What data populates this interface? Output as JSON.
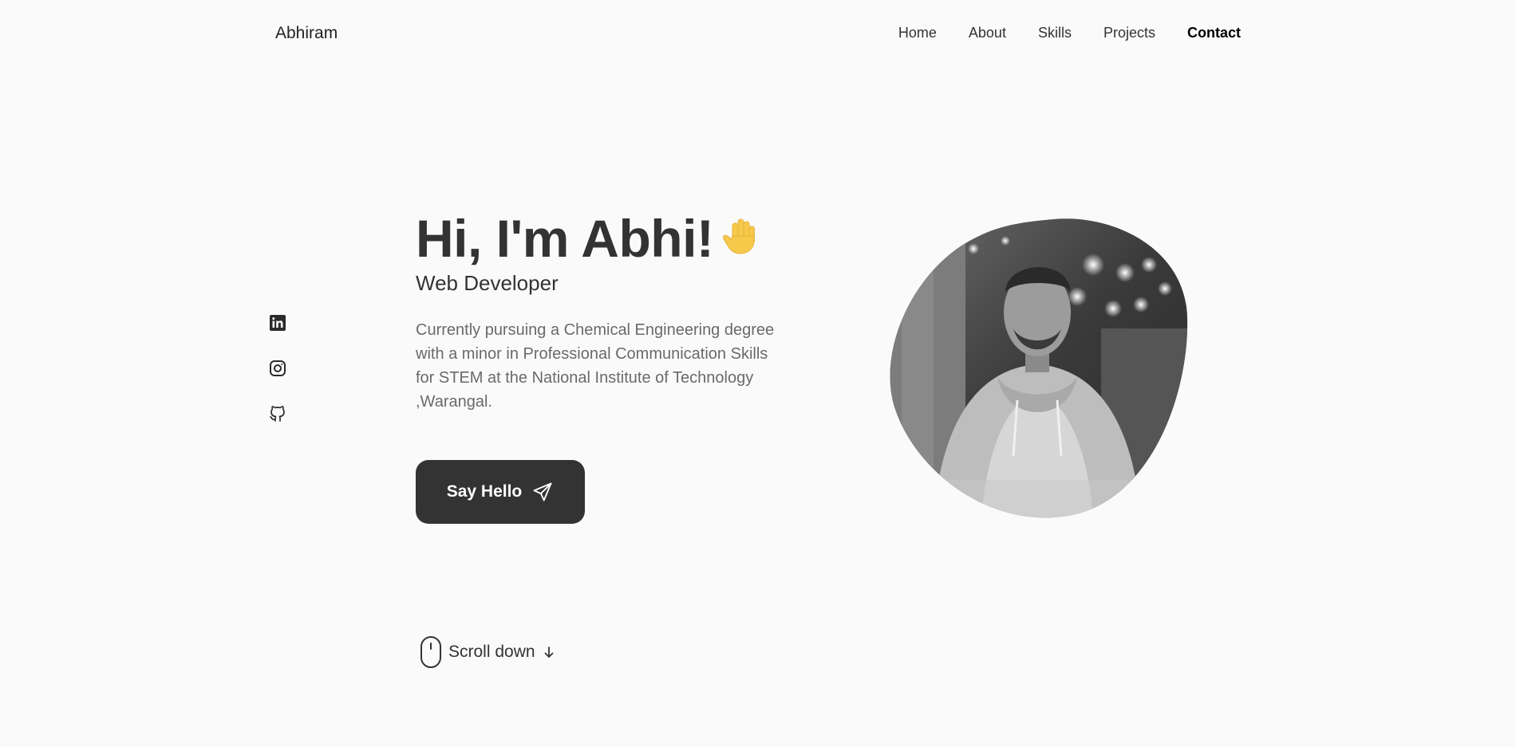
{
  "header": {
    "logo": "Abhiram",
    "nav": [
      {
        "label": "Home"
      },
      {
        "label": "About"
      },
      {
        "label": "Skills"
      },
      {
        "label": "Projects"
      },
      {
        "label": "Contact",
        "active": true
      }
    ]
  },
  "socials": [
    "linkedin-icon",
    "instagram-icon",
    "github-icon"
  ],
  "hero": {
    "title": "Hi, I'm Abhi!",
    "wave": "🖐",
    "subtitle": "Web Developer",
    "description": "Currently pursuing a Chemical Engineering degree with a minor in Professional Communication Skills for STEM at the National Institute of Technology ,Warangal.",
    "button_label": "Say Hello"
  },
  "scroll": {
    "label": "Scroll down"
  },
  "colors": {
    "background": "#fafafa",
    "text": "#333333",
    "muted": "#6a6a6a",
    "button": "#333333"
  }
}
